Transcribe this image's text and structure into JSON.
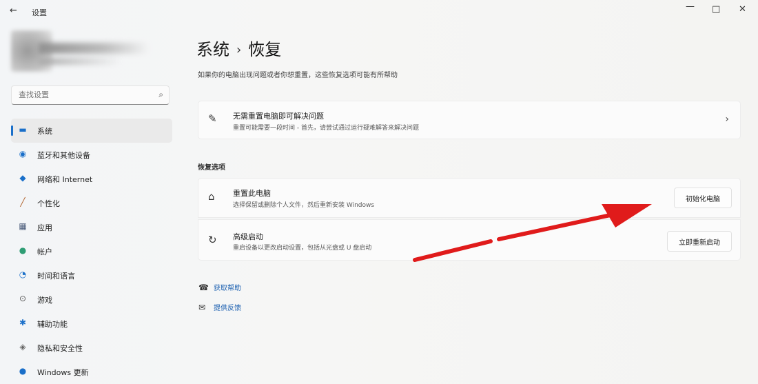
{
  "window": {
    "title": "设置",
    "back_glyph": "←",
    "minimize_glyph": "—",
    "maximize_glyph": "□",
    "close_glyph": "✕"
  },
  "search": {
    "placeholder": "查找设置"
  },
  "sidebar": {
    "items": [
      {
        "label": "系统",
        "icon": "monitor-icon",
        "glyph": "▬",
        "color": "#1a6fc9",
        "active": true
      },
      {
        "label": "蓝牙和其他设备",
        "icon": "bluetooth-icon",
        "glyph": "◉",
        "color": "#1a6fc9"
      },
      {
        "label": "网络和 Internet",
        "icon": "wifi-icon",
        "glyph": "◆",
        "color": "#1a6fc9"
      },
      {
        "label": "个性化",
        "icon": "brush-icon",
        "glyph": "╱",
        "color": "#b0602a"
      },
      {
        "label": "应用",
        "icon": "apps-icon",
        "glyph": "▦",
        "color": "#4a5b7a"
      },
      {
        "label": "帐户",
        "icon": "user-icon",
        "glyph": "●",
        "color": "#2e9d74"
      },
      {
        "label": "时间和语言",
        "icon": "clock-globe-icon",
        "glyph": "◔",
        "color": "#1a6fc9"
      },
      {
        "label": "游戏",
        "icon": "gamepad-icon",
        "glyph": "⊙",
        "color": "#555555"
      },
      {
        "label": "辅助功能",
        "icon": "accessibility-icon",
        "glyph": "✱",
        "color": "#1a6fc9"
      },
      {
        "label": "隐私和安全性",
        "icon": "shield-icon",
        "glyph": "◈",
        "color": "#666666"
      },
      {
        "label": "Windows 更新",
        "icon": "update-icon",
        "glyph": "●",
        "color": "#1a6fc9"
      }
    ]
  },
  "breadcrumb": {
    "parent": "系统",
    "separator": "›",
    "current": "恢复"
  },
  "description": "如果你的电脑出现问题或者你想重置，这些恢复选项可能有所帮助",
  "troubleshoot": {
    "title": "无需重置电脑即可解决问题",
    "desc": "重置可能需要一段时间 - 首先，请尝试通过运行疑难解答来解决问题",
    "icon_glyph": "✎",
    "chevron": "›"
  },
  "recovery_section": {
    "label": "恢复选项",
    "reset": {
      "title": "重置此电脑",
      "desc": "选择保留或删除个人文件，然后重新安装 Windows",
      "button": "初始化电脑",
      "icon_glyph": "⌂"
    },
    "advanced": {
      "title": "高级启动",
      "desc": "重启设备以更改启动设置，包括从光盘或 U 盘启动",
      "button": "立即重新启动",
      "icon_glyph": "↻"
    }
  },
  "links": [
    {
      "label": "获取帮助",
      "icon": "help-icon",
      "glyph": "☎"
    },
    {
      "label": "提供反馈",
      "icon": "feedback-icon",
      "glyph": "✉"
    }
  ],
  "annotation": {
    "arrow_color": "#e01b1b"
  }
}
